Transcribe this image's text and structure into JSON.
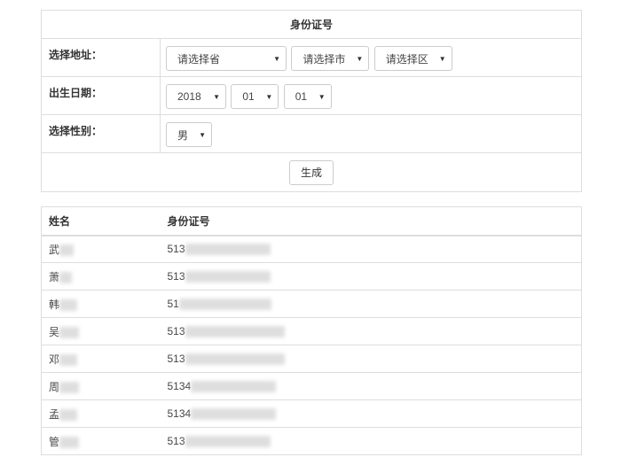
{
  "form": {
    "title": "身份证号",
    "address_label": "选择地址：",
    "province": "请选择省",
    "city": "请选择市",
    "district": "请选择区",
    "birth_label": "出生日期：",
    "year": "2018",
    "month": "01",
    "day": "01",
    "gender_label": "选择性别：",
    "gender": "男",
    "generate_label": "生成"
  },
  "results": {
    "headers": [
      "姓名",
      "身份证号"
    ],
    "rows": [
      {
        "name": "武",
        "id": "513"
      },
      {
        "name": "萧",
        "id": "513"
      },
      {
        "name": "韩",
        "id": "51"
      },
      {
        "name": "吴",
        "id": "513"
      },
      {
        "name": "邓",
        "id": "513"
      },
      {
        "name": "周",
        "id": "5134"
      },
      {
        "name": "孟",
        "id": "5134"
      },
      {
        "name": "管",
        "id": "513"
      }
    ]
  }
}
